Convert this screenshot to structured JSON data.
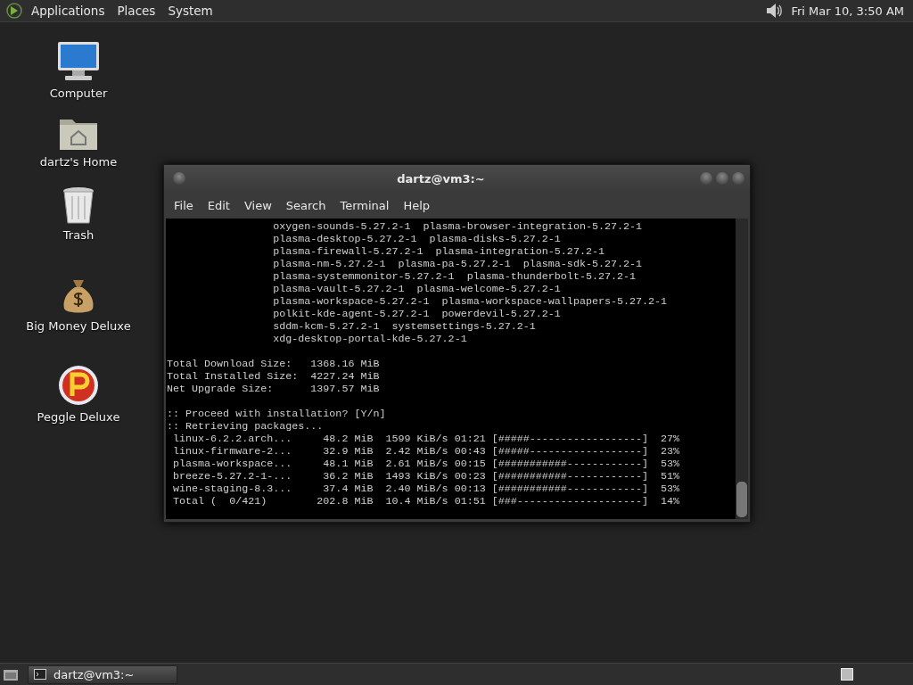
{
  "top_panel": {
    "menus": [
      "Applications",
      "Places",
      "System"
    ],
    "clock": "Fri Mar 10, 3:50 AM"
  },
  "desktop_icons": [
    {
      "kind": "computer",
      "label": "Computer"
    },
    {
      "kind": "home",
      "label": "dartz's Home"
    },
    {
      "kind": "trash",
      "label": "Trash"
    },
    {
      "kind": "money",
      "label": "Big Money Deluxe"
    },
    {
      "kind": "peggle",
      "label": "Peggle Deluxe"
    }
  ],
  "terminal": {
    "title": "dartz@vm3:~",
    "menu": [
      "File",
      "Edit",
      "View",
      "Search",
      "Terminal",
      "Help"
    ],
    "blocks": [
      [
        "                 oxygen-sounds-5.27.2-1  plasma-browser-integration-5.27.2-1",
        "                 plasma-desktop-5.27.2-1  plasma-disks-5.27.2-1",
        "                 plasma-firewall-5.27.2-1  plasma-integration-5.27.2-1",
        "                 plasma-nm-5.27.2-1  plasma-pa-5.27.2-1  plasma-sdk-5.27.2-1",
        "                 plasma-systemmonitor-5.27.2-1  plasma-thunderbolt-5.27.2-1",
        "                 plasma-vault-5.27.2-1  plasma-welcome-5.27.2-1",
        "                 plasma-workspace-5.27.2-1  plasma-workspace-wallpapers-5.27.2-1",
        "                 polkit-kde-agent-5.27.2-1  powerdevil-5.27.2-1",
        "                 sddm-kcm-5.27.2-1  systemsettings-5.27.2-1",
        "                 xdg-desktop-portal-kde-5.27.2-1"
      ],
      [
        "Total Download Size:   1368.16 MiB",
        "Total Installed Size:  4227.24 MiB",
        "Net Upgrade Size:      1397.57 MiB"
      ],
      [
        ":: Proceed with installation? [Y/n]",
        ":: Retrieving packages...",
        " linux-6.2.2.arch...     48.2 MiB  1599 KiB/s 01:21 [#####------------------]  27%",
        " linux-firmware-2...     32.9 MiB  2.42 MiB/s 00:43 [#####------------------]  23%",
        " plasma-workspace...     48.1 MiB  2.61 MiB/s 00:15 [###########------------]  53%",
        " breeze-5.27.2-1-...     36.2 MiB  1493 KiB/s 00:23 [###########------------]  51%",
        " wine-staging-8.3...     37.4 MiB  2.40 MiB/s 00:13 [###########------------]  53%",
        " Total (  0/421)        202.8 MiB  10.4 MiB/s 01:51 [###--------------------]  14%"
      ]
    ]
  },
  "taskbar": {
    "tasks": [
      {
        "label": "dartz@vm3:~",
        "selected": true
      }
    ]
  }
}
